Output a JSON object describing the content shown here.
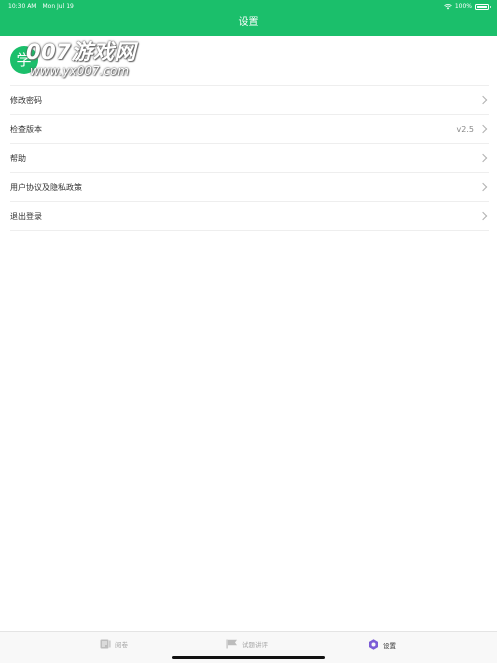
{
  "status_bar": {
    "time": "10:30 AM",
    "date": "Mon Jul 19",
    "battery": "100%"
  },
  "header": {
    "title": "设置"
  },
  "profile": {
    "avatar_char": "学"
  },
  "watermark": {
    "line1": "007游戏网",
    "line2": "www.yx007.com"
  },
  "settings": {
    "items": [
      {
        "label": "修改密码",
        "value": ""
      },
      {
        "label": "检查版本",
        "value": "v2.5"
      },
      {
        "label": "帮助",
        "value": ""
      },
      {
        "label": "用户协议及隐私政策",
        "value": ""
      },
      {
        "label": "退出登录",
        "value": ""
      }
    ]
  },
  "tabbar": {
    "tabs": [
      {
        "label": "阅卷",
        "icon": "paper-icon",
        "active": false
      },
      {
        "label": "试题讲评",
        "icon": "flag-icon",
        "active": false
      },
      {
        "label": "设置",
        "icon": "gear-icon",
        "active": true
      }
    ]
  },
  "colors": {
    "brand": "#1bbf6b",
    "active_tab_icon": "#7b5cd6"
  }
}
